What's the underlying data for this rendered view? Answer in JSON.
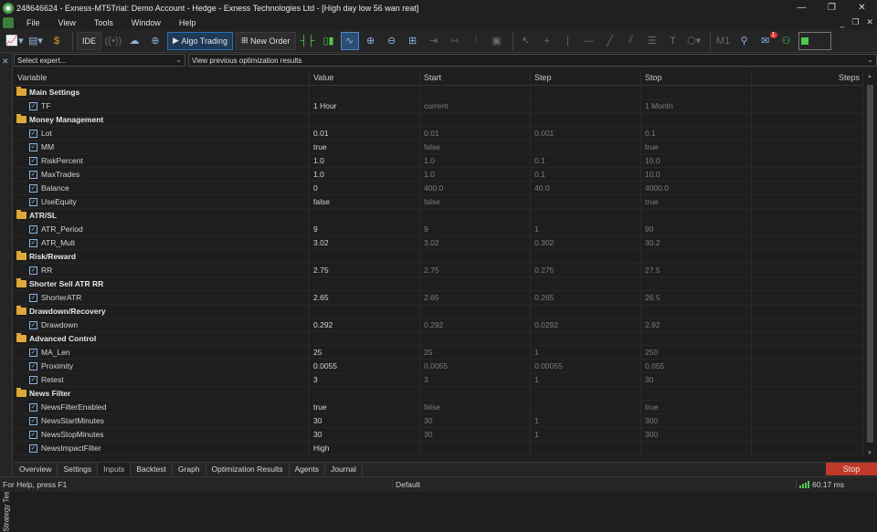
{
  "window": {
    "title": "248646624 - Exness-MT5Trial: Demo Account - Hedge - Exness Technologies Ltd - [High day low 56 wan reat]",
    "controls": [
      "—",
      "❐",
      "✕"
    ]
  },
  "menu": {
    "items": [
      "File",
      "View",
      "Tools",
      "Window",
      "Help"
    ],
    "mdi_controls": [
      "_",
      "❐",
      "✕"
    ]
  },
  "toolbar": {
    "ide_label": "IDE",
    "algo_trading_label": "Algo Trading",
    "new_order_label": "New Order",
    "timeframe_label": "M1",
    "notification_count": "1"
  },
  "side_panel": {
    "label": "Strategy Tester",
    "close": "✕"
  },
  "selectors": {
    "expert": "Select expert...",
    "optimization": "View previous optimization results"
  },
  "grid": {
    "columns": [
      "Variable",
      "Value",
      "Start",
      "Step",
      "Stop",
      "Steps"
    ],
    "rows": [
      {
        "type": "group",
        "name": "Main Settings"
      },
      {
        "type": "param",
        "name": "TF",
        "value": "1 Hour",
        "start": "current",
        "step": "",
        "stop": "1 Month"
      },
      {
        "type": "group",
        "name": "Money Management"
      },
      {
        "type": "param",
        "name": "Lot",
        "value": "0.01",
        "start": "0.01",
        "step": "0.001",
        "stop": "0.1"
      },
      {
        "type": "param",
        "name": "MM",
        "value": "true",
        "start": "false",
        "step": "",
        "stop": "true"
      },
      {
        "type": "param",
        "name": "RiskPercent",
        "value": "1.0",
        "start": "1.0",
        "step": "0.1",
        "stop": "10.0"
      },
      {
        "type": "param",
        "name": "MaxTrades",
        "value": "1.0",
        "start": "1.0",
        "step": "0.1",
        "stop": "10.0"
      },
      {
        "type": "param",
        "name": "Balance",
        "value": "0",
        "start": "400.0",
        "step": "40.0",
        "stop": "4000.0"
      },
      {
        "type": "param",
        "name": "UseEquity",
        "value": "false",
        "start": "false",
        "step": "",
        "stop": "true"
      },
      {
        "type": "group",
        "name": "ATR/SL"
      },
      {
        "type": "param",
        "name": "ATR_Period",
        "value": "9",
        "start": "9",
        "step": "1",
        "stop": "90"
      },
      {
        "type": "param",
        "name": "ATR_Mult",
        "value": "3.02",
        "start": "3.02",
        "step": "0.302",
        "stop": "30.2"
      },
      {
        "type": "group",
        "name": "Risk/Reward"
      },
      {
        "type": "param",
        "name": "RR",
        "value": "2.75",
        "start": "2.75",
        "step": "0.275",
        "stop": "27.5"
      },
      {
        "type": "group",
        "name": "Shorter Sell ATR RR"
      },
      {
        "type": "param",
        "name": "ShorterATR",
        "value": "2.65",
        "start": "2.65",
        "step": "0.265",
        "stop": "26.5"
      },
      {
        "type": "group",
        "name": "Drawdown/Recovery"
      },
      {
        "type": "param",
        "name": "Drawdown",
        "value": "0.292",
        "start": "0.292",
        "step": "0.0292",
        "stop": "2.92"
      },
      {
        "type": "group",
        "name": "Advanced Control"
      },
      {
        "type": "param",
        "name": "MA_Len",
        "value": "25",
        "start": "25",
        "step": "1",
        "stop": "250"
      },
      {
        "type": "param",
        "name": "Proximity",
        "value": "0.0055",
        "start": "0.0055",
        "step": "0.00055",
        "stop": "0.055"
      },
      {
        "type": "param",
        "name": "Retest",
        "value": "3",
        "start": "3",
        "step": "1",
        "stop": "30"
      },
      {
        "type": "group",
        "name": "News Filter"
      },
      {
        "type": "param",
        "name": "NewsFilterEnabled",
        "value": "true",
        "start": "false",
        "step": "",
        "stop": "true"
      },
      {
        "type": "param",
        "name": "NewsStartMinutes",
        "value": "30",
        "start": "30",
        "step": "1",
        "stop": "300"
      },
      {
        "type": "param",
        "name": "NewsStopMinutes",
        "value": "30",
        "start": "30",
        "step": "1",
        "stop": "300"
      },
      {
        "type": "param",
        "name": "NewsImpactFilter",
        "value": "High",
        "start": "",
        "step": "",
        "stop": ""
      }
    ]
  },
  "tabs": [
    "Overview",
    "Settings",
    "Inputs",
    "Backtest",
    "Graph",
    "Optimization Results",
    "Agents",
    "Journal"
  ],
  "active_tab": "Inputs",
  "stop_button": "Stop",
  "status": {
    "help": "For Help, press F1",
    "profile": "Default",
    "ping": "60.17 ms"
  },
  "colors": {
    "accent": "#2a6fb5",
    "stop": "#c0392b",
    "folder": "#e0a83a",
    "connection": "#4ec94e"
  }
}
